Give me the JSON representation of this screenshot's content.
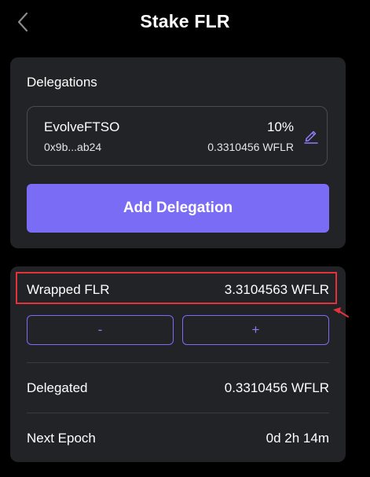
{
  "header": {
    "title": "Stake FLR",
    "back_icon": "chevron-left-icon"
  },
  "delegations": {
    "title": "Delegations",
    "items": [
      {
        "name": "EvolveFTSO",
        "address": "0x9b...ab24",
        "percent": "10%",
        "amount": "0.3310456 WFLR"
      }
    ],
    "add_button_label": "Add Delegation"
  },
  "balance": {
    "wrapped_label": "Wrapped FLR",
    "wrapped_value": "3.3104563 WFLR",
    "minus_label": "-",
    "plus_label": "+",
    "delegated_label": "Delegated",
    "delegated_value": "0.3310456 WFLR",
    "epoch_label": "Next Epoch",
    "epoch_value": "0d 2h 14m"
  },
  "colors": {
    "background": "#000000",
    "card": "#222327",
    "accent": "#7b6cf6",
    "highlight": "#e5323a"
  }
}
